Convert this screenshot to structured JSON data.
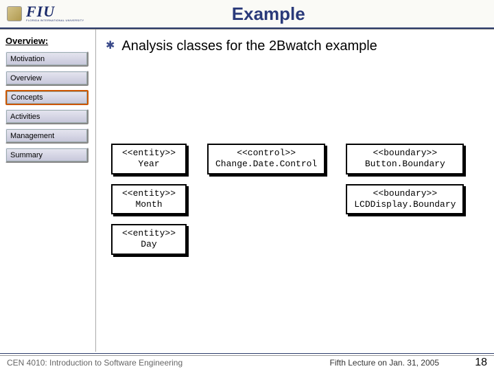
{
  "header": {
    "title": "Example",
    "logo_text": "FIU",
    "logo_sub": "FLORIDA INTERNATIONAL UNIVERSITY"
  },
  "sidebar": {
    "section_label": "Overview:",
    "items": [
      {
        "label": "Motivation"
      },
      {
        "label": "Overview"
      },
      {
        "label": "Concepts"
      },
      {
        "label": "Activities"
      },
      {
        "label": "Management"
      },
      {
        "label": "Summary"
      }
    ],
    "active_index": 2
  },
  "main": {
    "bullet": "Analysis classes for the 2Bwatch example"
  },
  "uml": {
    "col1": [
      {
        "stereo": "<<entity>>",
        "name": "Year"
      },
      {
        "stereo": "<<entity>>",
        "name": "Month"
      },
      {
        "stereo": "<<entity>>",
        "name": "Day"
      }
    ],
    "col2": [
      {
        "stereo": "<<control>>",
        "name": "Change.Date.Control"
      }
    ],
    "col3": [
      {
        "stereo": "<<boundary>>",
        "name": "Button.Boundary"
      },
      {
        "stereo": "<<boundary>>",
        "name": "LCDDisplay.Boundary"
      }
    ]
  },
  "footer": {
    "left": "CEN 4010: Introduction to Software Engineering",
    "center": "Fifth Lecture on Jan. 31, 2005",
    "right": "18"
  }
}
